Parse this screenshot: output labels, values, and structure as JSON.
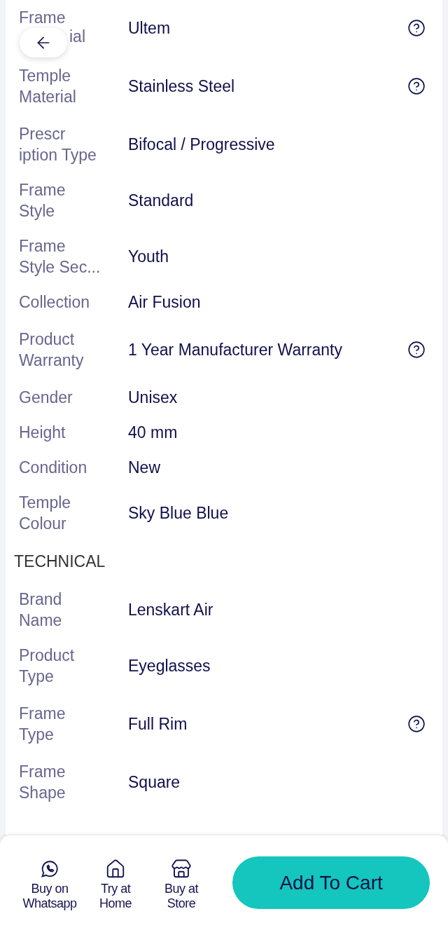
{
  "general_rows": [
    {
      "label_parts": [
        "Frame",
        "ial"
      ],
      "value": "Ultem",
      "help": true
    },
    {
      "label_parts": [
        "Temple",
        "Material"
      ],
      "value": "Stainless Steel",
      "help": true
    },
    {
      "label_parts": [
        "Prescr",
        "iption Type"
      ],
      "value": "Bifocal / Progressive",
      "help": false
    },
    {
      "label_parts": [
        "Frame",
        "Style"
      ],
      "value": "Standard",
      "help": false
    },
    {
      "label_parts": [
        "Frame",
        "Style Sec..."
      ],
      "value": "Youth",
      "help": false
    },
    {
      "label_parts": [
        "Collection"
      ],
      "value": "Air Fusion",
      "help": false
    },
    {
      "label_parts": [
        "Product",
        "Warranty"
      ],
      "value": "1 Year Manufacturer Warranty",
      "help": true
    },
    {
      "label_parts": [
        "Gender"
      ],
      "value": "Unisex",
      "help": false
    },
    {
      "label_parts": [
        "Height"
      ],
      "value": "40 mm",
      "help": false
    },
    {
      "label_parts": [
        "Condition"
      ],
      "value": "New",
      "help": false
    },
    {
      "label_parts": [
        "Temple",
        "Colour"
      ],
      "value": "Sky Blue Blue",
      "help": false
    }
  ],
  "section_title": "TECHNICAL",
  "technical_rows": [
    {
      "label_parts": [
        "Brand",
        "Name"
      ],
      "value": "Lenskart Air",
      "help": false
    },
    {
      "label_parts": [
        "Product",
        "Type"
      ],
      "value": "Eyeglasses",
      "help": false
    },
    {
      "label_parts": [
        "Frame",
        "Type"
      ],
      "value": "Full Rim",
      "help": true
    },
    {
      "label_parts": [
        "Frame",
        "Shape"
      ],
      "value": "Square",
      "help": false
    }
  ],
  "bottom_bar": {
    "actions": [
      {
        "kind": "whatsapp",
        "label_lines": [
          "Buy on",
          "Whatsapp"
        ]
      },
      {
        "kind": "home",
        "label_lines": [
          "Try at",
          "Home"
        ]
      },
      {
        "kind": "store",
        "label_lines": [
          "Buy at",
          "Store"
        ]
      }
    ],
    "cart_button": "Add To Cart"
  }
}
